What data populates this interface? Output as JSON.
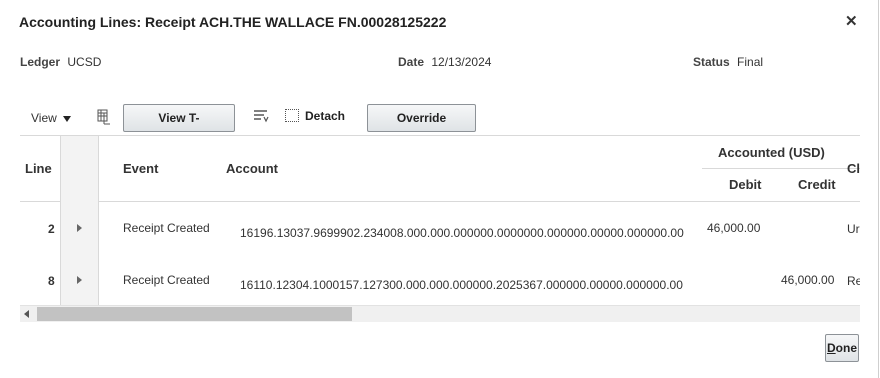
{
  "dialog": {
    "title": "Accounting Lines: Receipt ACH.THE WALLACE FN.00028125222",
    "close_glyph": "✕"
  },
  "meta": {
    "ledger_label": "Ledger",
    "ledger_value": "UCSD",
    "date_label": "Date",
    "date_value": "12/13/2024",
    "status_label": "Status",
    "status_value": "Final"
  },
  "toolbar": {
    "view_label": "View",
    "freeze_icon": "freeze-columns-icon",
    "taccounts_label": "View T-Accounts",
    "wrap_icon": "wrap-icon",
    "detach_label": "Detach",
    "override_label": "Override Account"
  },
  "table": {
    "headers": {
      "line": "Line",
      "event": "Event",
      "account": "Account",
      "accounted_group": "Accounted (USD)",
      "debit": "Debit",
      "credit": "Credit",
      "cl": "Cl"
    },
    "rows": [
      {
        "line": "2",
        "event": "Receipt Created",
        "account": "16196.13037.9699902.234008.000.000.000000.0000000.000000.00000.000000.00",
        "debit": "46,000.00",
        "credit": "",
        "cl": "Ur"
      },
      {
        "line": "8",
        "event": "Receipt Created",
        "account": "16110.12304.1000157.127300.000.000.000000.2025367.000000.00000.000000.00",
        "debit": "",
        "credit": "46,000.00",
        "cl": "Re"
      }
    ]
  },
  "footer": {
    "done_prefix": "D",
    "done_rest": "one"
  }
}
